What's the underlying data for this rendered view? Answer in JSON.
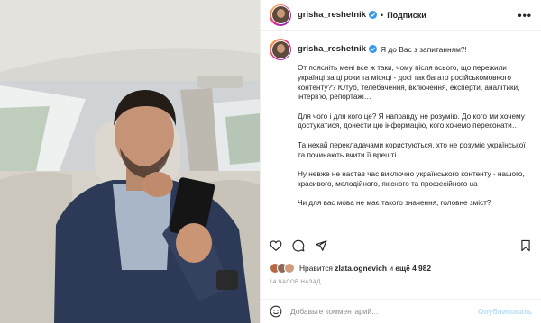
{
  "post": {
    "username": "grisha_reshetnik",
    "separator": "•",
    "follow_label": "Подписки",
    "more_label": "•••"
  },
  "caption": {
    "first_line": "Я до Вас з запитанням?!",
    "paragraphs": [
      "От поясніть мені все ж таки, чому після всього, що пережили українці за ці роки та місяці - досі так багато російськомовного контенту?? Ютуб, телебачення, включення, експерти, аналітики, інтерв'ю, репортажі…",
      "Для чого і для кого це? Я направду не розумію. До кого ми хочему достукатися, донести цю інформацію, кого хочемо переконати…",
      "Та нехай перекладачами користуються, хто не розуміє української та починають вчити її врешті.",
      "Ну невже не настав час виключно українського контенту - нашого, красивого, мелодійного, якісного та професійного ua",
      "Чи для вас мова не має такого значення, головне зміст?"
    ]
  },
  "likes": {
    "prefix": "Нравится",
    "user": "zlata.ognevich",
    "middle": "и",
    "count_text": "ещё 4 982"
  },
  "timestamp": "14 ЧАСОВ НАЗАД",
  "comment": {
    "placeholder": "Добавьте комментарий...",
    "publish_label": "Опубликовать"
  },
  "icons": {
    "like": "heart-icon",
    "comment": "comment-icon",
    "share": "share-icon",
    "save": "bookmark-icon",
    "emoji": "emoji-icon",
    "verified": "verified-badge-icon"
  },
  "colors": {
    "text": "#262626",
    "muted": "#8e8e8e",
    "verified": "#3897f0",
    "publish_disabled": "#b2dffc"
  }
}
